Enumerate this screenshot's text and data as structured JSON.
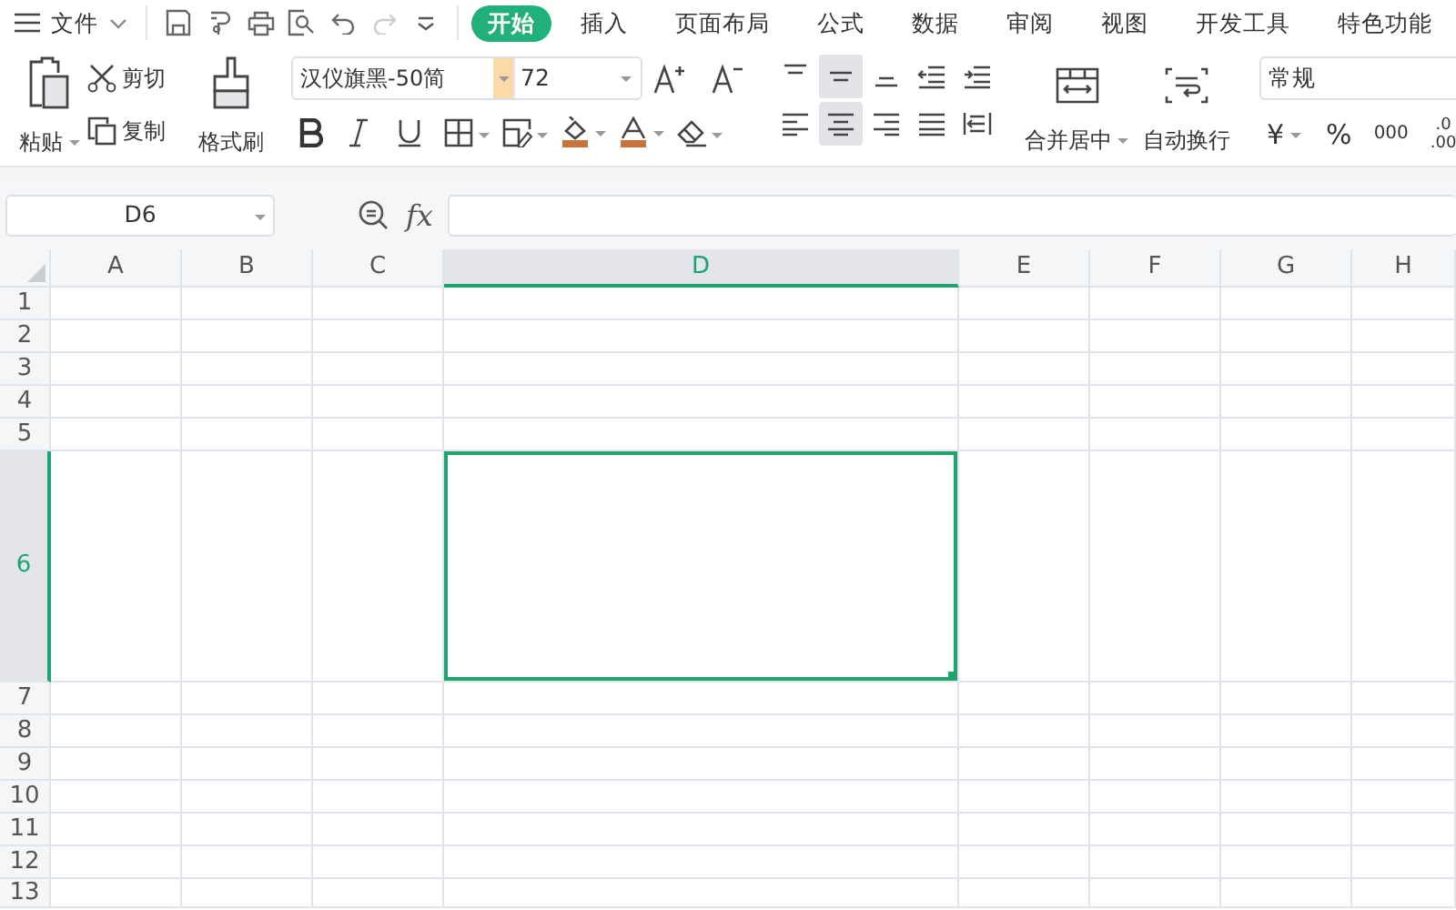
{
  "menu": {
    "file": "文件"
  },
  "quick_access": {
    "redo": {
      "disabled": true
    }
  },
  "tabs": [
    {
      "label": "开始",
      "selected": true
    },
    {
      "label": "插入",
      "selected": false
    },
    {
      "label": "页面布局",
      "selected": false
    },
    {
      "label": "公式",
      "selected": false
    },
    {
      "label": "数据",
      "selected": false
    },
    {
      "label": "审阅",
      "selected": false
    },
    {
      "label": "视图",
      "selected": false
    },
    {
      "label": "开发工具",
      "selected": false
    },
    {
      "label": "特色功能",
      "selected": false
    }
  ],
  "clipboard": {
    "paste": "粘贴",
    "cut": "剪切",
    "copy": "复制",
    "format_painter": "格式刷"
  },
  "font": {
    "name": "汉仪旗黑-50简",
    "size": "72"
  },
  "alignment": {
    "vertical": [
      {
        "selected": false
      },
      {
        "selected": true
      },
      {
        "selected": false
      }
    ],
    "horizontal": [
      {
        "selected": false
      },
      {
        "selected": true
      },
      {
        "selected": false
      }
    ],
    "merge_center": "合并居中",
    "wrap_text": "自动换行"
  },
  "number": {
    "format": "常规",
    "currency": "¥",
    "percent": "%",
    "thousands": "000",
    "decimal_top": ".0",
    "decimal_bottom": ".00"
  },
  "name_box": "D6",
  "formula_bar": {
    "function_label": "fx"
  },
  "columns": [
    {
      "label": "A",
      "selected": false
    },
    {
      "label": "B",
      "selected": false
    },
    {
      "label": "C",
      "selected": false
    },
    {
      "label": "D",
      "selected": true
    },
    {
      "label": "E",
      "selected": false
    },
    {
      "label": "F",
      "selected": false
    },
    {
      "label": "G",
      "selected": false
    },
    {
      "label": "H",
      "selected": false
    }
  ],
  "rows": [
    {
      "label": "1",
      "selected": false
    },
    {
      "label": "2",
      "selected": false
    },
    {
      "label": "3",
      "selected": false
    },
    {
      "label": "4",
      "selected": false
    },
    {
      "label": "5",
      "selected": false
    },
    {
      "label": "6",
      "selected": true
    },
    {
      "label": "7",
      "selected": false
    },
    {
      "label": "8",
      "selected": false
    },
    {
      "label": "9",
      "selected": false
    },
    {
      "label": "10",
      "selected": false
    },
    {
      "label": "11",
      "selected": false
    },
    {
      "label": "12",
      "selected": false
    },
    {
      "label": "13",
      "selected": false
    }
  ]
}
